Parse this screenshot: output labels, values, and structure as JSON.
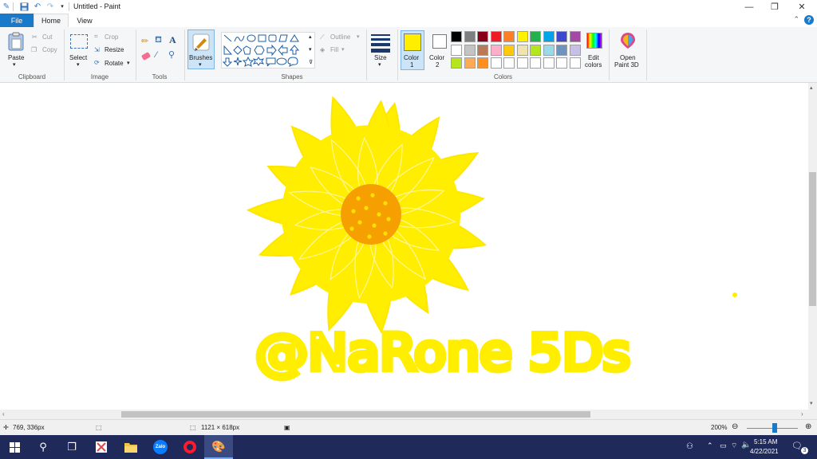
{
  "window": {
    "title": "Untitled - Paint"
  },
  "tabs": {
    "file": "File",
    "home": "Home",
    "view": "View"
  },
  "ribbon": {
    "clipboard": {
      "paste": "Paste",
      "cut": "Cut",
      "copy": "Copy",
      "group": "Clipboard"
    },
    "image": {
      "select": "Select",
      "crop": "Crop",
      "resize": "Resize",
      "rotate": "Rotate",
      "group": "Image"
    },
    "tools": {
      "group": "Tools"
    },
    "brushes": {
      "label": "Brushes"
    },
    "shapes": {
      "outline": "Outline",
      "fill": "Fill",
      "group": "Shapes"
    },
    "size": {
      "label": "Size"
    },
    "colors": {
      "color1": "Color",
      "color1_num": "1",
      "color2": "Color",
      "color2_num": "2",
      "color1_value": "#ffee00",
      "color2_value": "#ffffff",
      "edit_line1": "Edit",
      "edit_line2": "colors",
      "group": "Colors",
      "row1": [
        "#000000",
        "#7f7f7f",
        "#880015",
        "#ed1c24",
        "#ff7f27",
        "#fff200",
        "#22b14c",
        "#00a2e8",
        "#3f48cc",
        "#a349a4"
      ],
      "row2": [
        "#ffffff",
        "#c3c3c3",
        "#b97a57",
        "#ffaec9",
        "#ffc90e",
        "#efe4b0",
        "#b5e61d",
        "#99d9ea",
        "#7092be",
        "#c8bfe7"
      ],
      "row3": [
        "#b5e61d",
        "#ffaa55",
        "#ff9020",
        "#ffffff",
        "#ffffff",
        "#ffffff",
        "#ffffff",
        "#ffffff",
        "#ffffff",
        "#ffffff"
      ]
    },
    "paint3d": {
      "line1": "Open",
      "line2": "Paint 3D"
    }
  },
  "canvas": {
    "petal_color": "#ffee00",
    "petal_edge": "#ffe600",
    "center_color": "#f5a000",
    "dot_color": "#ffe000",
    "signature": "@NaRone 5Ds"
  },
  "status": {
    "cursor_pos": "769, 336px",
    "image_size": "1121 × 618px",
    "zoom": "200%",
    "zoom_fraction": 0.55
  },
  "taskbar": {
    "time": "5:15 AM",
    "date": "4/22/2021",
    "notification_count": "3",
    "zalo_label": "Zalo"
  }
}
